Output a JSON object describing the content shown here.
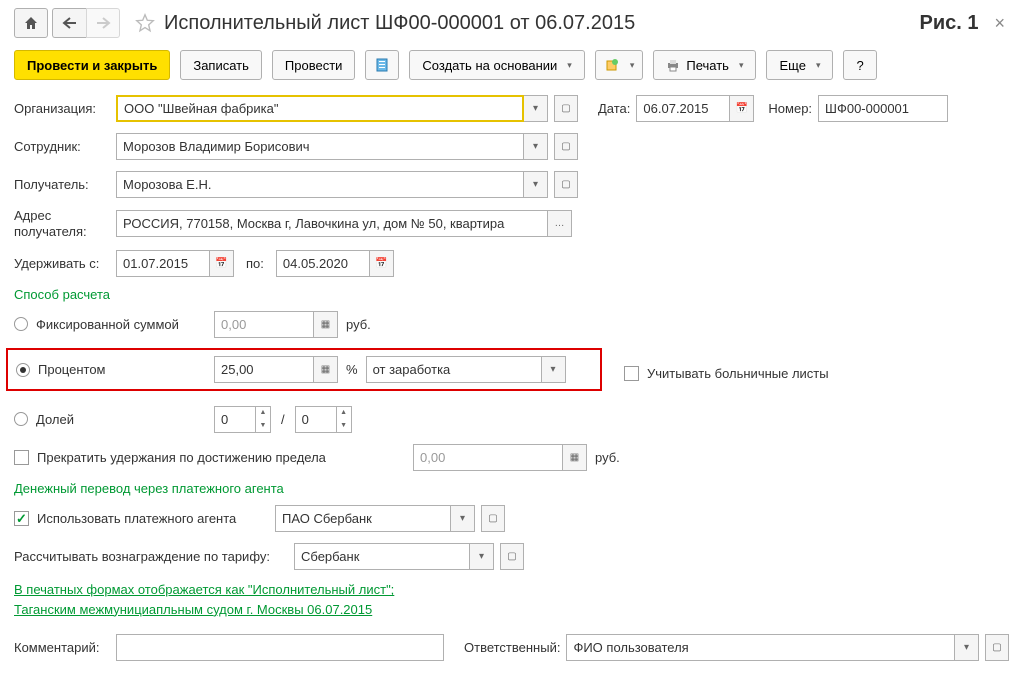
{
  "header": {
    "title": "Исполнительный лист ШФ00-000001 от 06.07.2015",
    "figure_label": "Рис. 1"
  },
  "toolbar": {
    "post_close": "Провести и закрыть",
    "save": "Записать",
    "post": "Провести",
    "create_based": "Создать на основании",
    "print": "Печать",
    "more": "Еще",
    "help": "?"
  },
  "form": {
    "org_label": "Организация:",
    "org_value": "ООО \"Швейная фабрика\"",
    "date_label": "Дата:",
    "date_value": "06.07.2015",
    "number_label": "Номер:",
    "number_value": "ШФ00-000001",
    "employee_label": "Сотрудник:",
    "employee_value": "Морозов Владимир Борисович",
    "recipient_label": "Получатель:",
    "recipient_value": "Морозова Е.Н.",
    "address_label1": "Адрес",
    "address_label2": "получателя:",
    "address_value": "РОССИЯ, 770158, Москва г, Лавочкина ул, дом № 50, квартира",
    "withhold_label": "Удерживать с:",
    "withhold_from": "01.07.2015",
    "withhold_to_label": "по:",
    "withhold_to": "04.05.2020"
  },
  "calc": {
    "header": "Способ расчета",
    "fixed_label": "Фиксированной суммой",
    "fixed_value": "0,00",
    "fixed_unit": "руб.",
    "percent_label": "Процентом",
    "percent_value": "25,00",
    "percent_unit": "%",
    "percent_base": "от заработка",
    "sick_leave": "Учитывать больничные листы",
    "share_label": "Долей",
    "share_num": "0",
    "share_den": "0",
    "share_sep": "/",
    "limit_label": "Прекратить удержания по достижению предела",
    "limit_value": "0,00",
    "limit_unit": "руб."
  },
  "agent": {
    "header": "Денежный перевод через платежного агента",
    "use_agent": "Использовать платежного агента",
    "agent_value": "ПАО Сбербанк",
    "tariff_label": "Рассчитывать вознаграждение по тарифу:",
    "tariff_value": "Сбербанк",
    "print_link1": "В печатных формах отображается как \"Исполнительный лист\";",
    "print_link2": "Таганским межмунициапльным судом г. Москвы 06.07.2015"
  },
  "footer": {
    "comment_label": "Комментарий:",
    "comment_value": "",
    "responsible_label": "Ответственный:",
    "responsible_value": "ФИО пользователя"
  }
}
